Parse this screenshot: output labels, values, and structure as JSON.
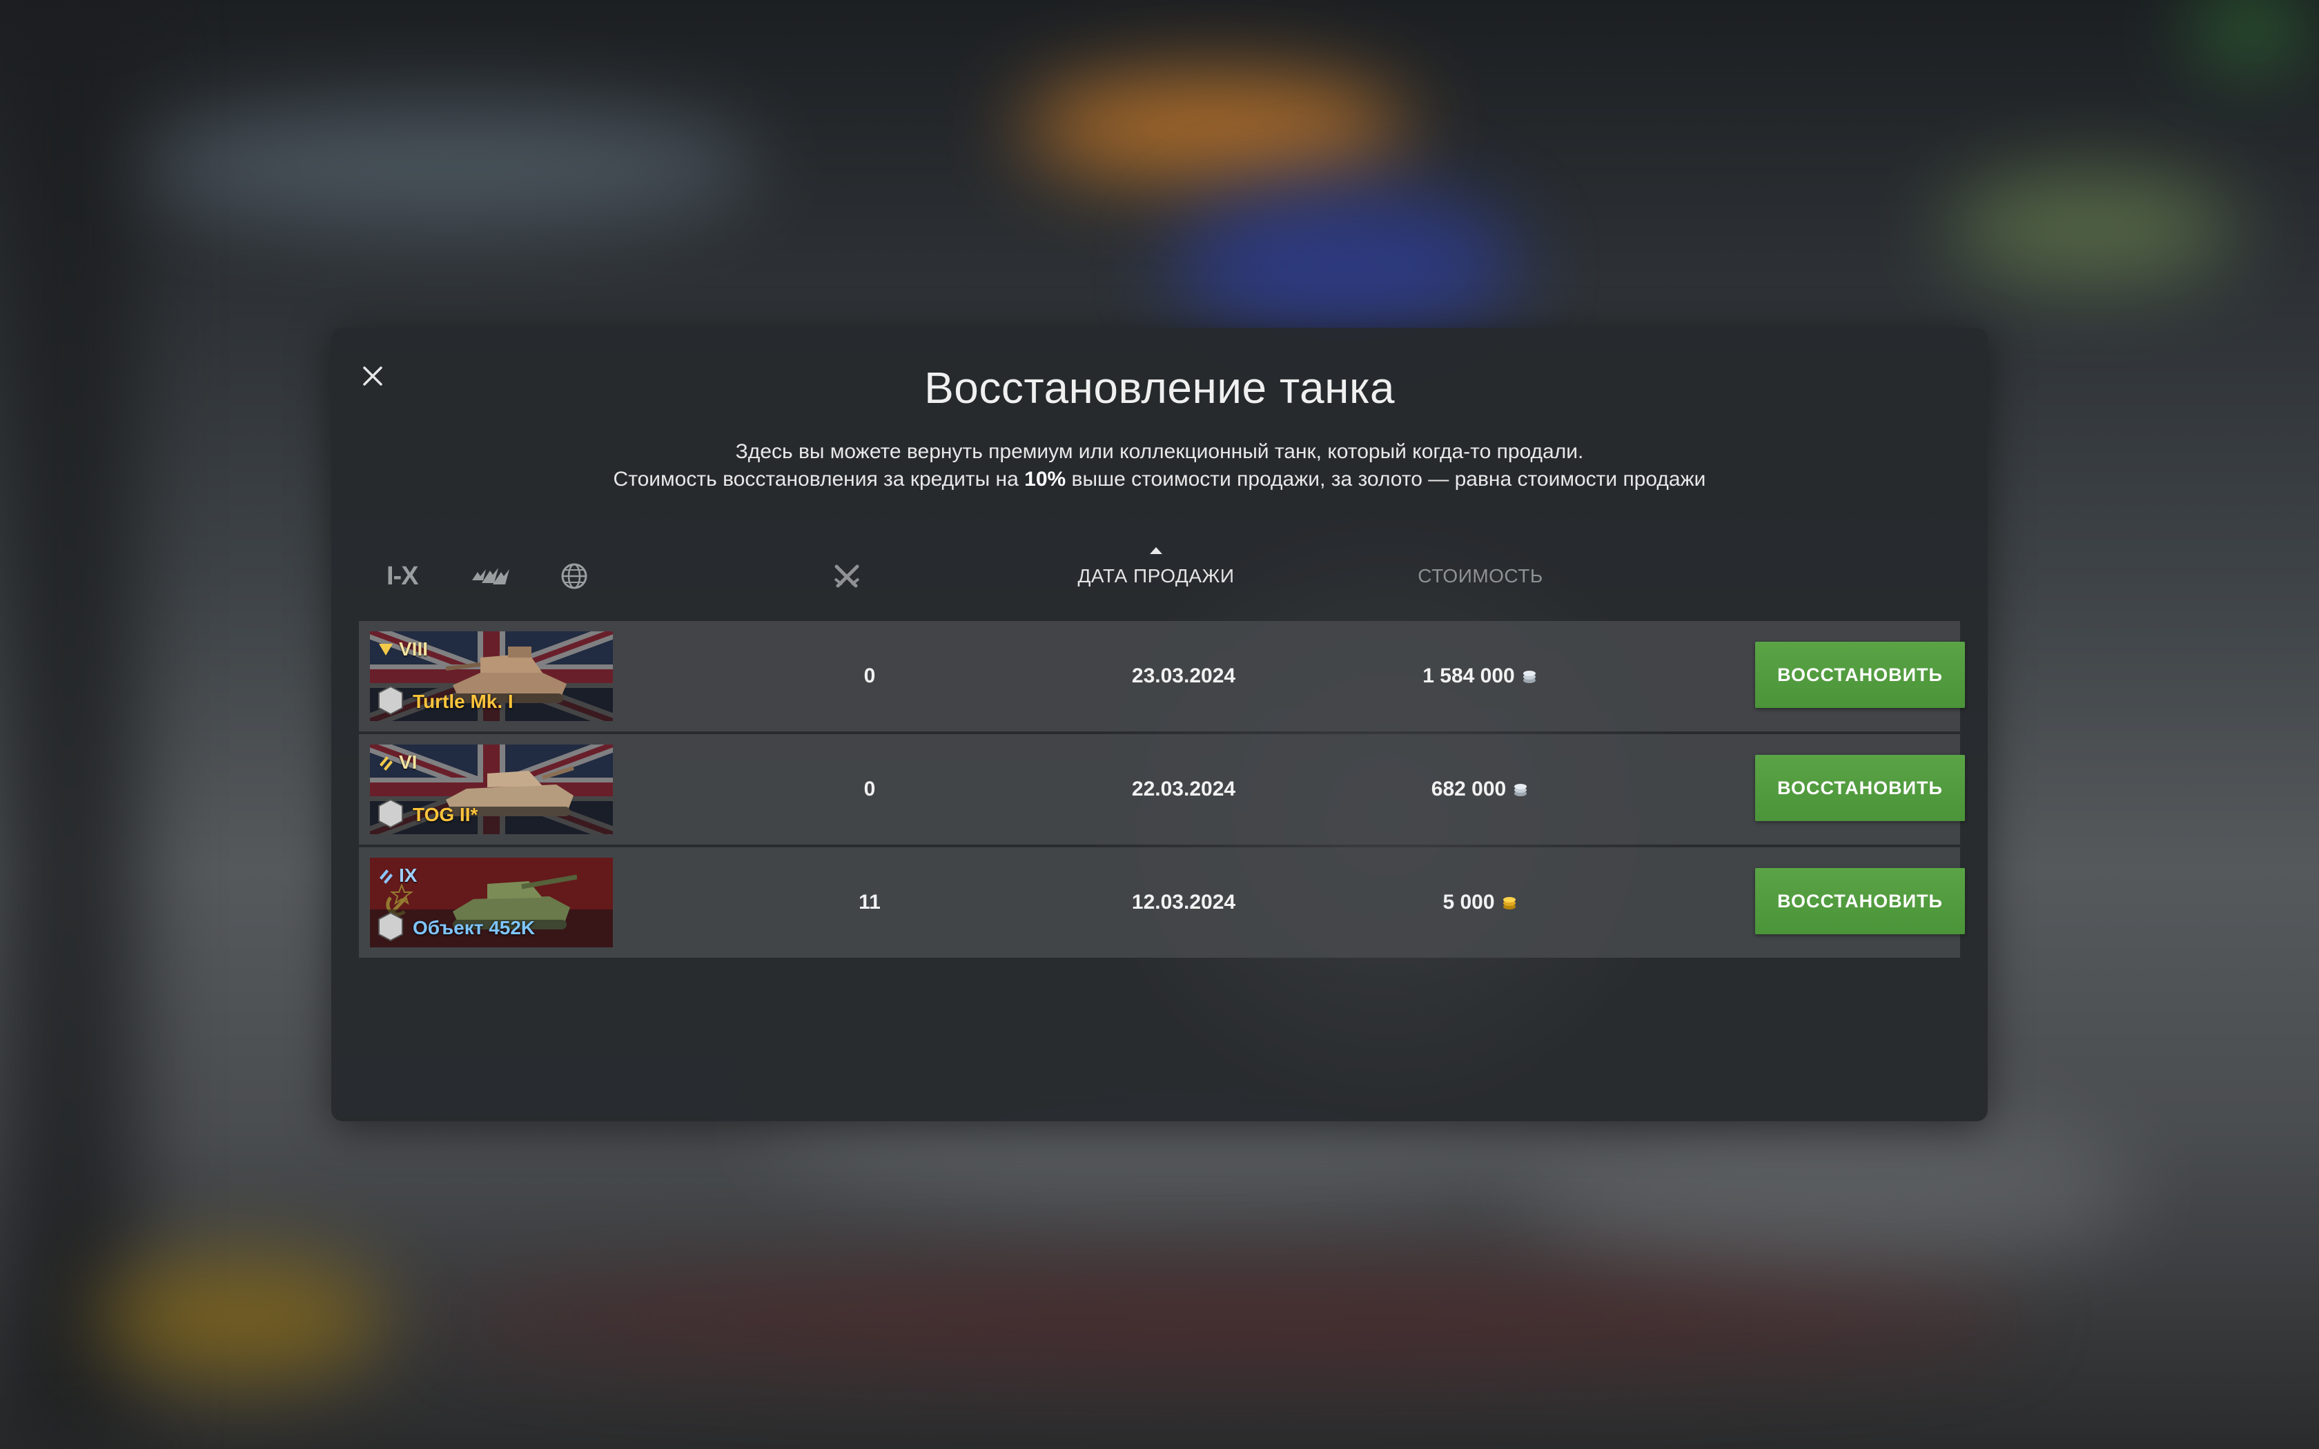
{
  "dialog": {
    "title": "Восстановление танка",
    "desc_line1": "Здесь вы можете вернуть премиум или коллекционный танк, который когда-то продали.",
    "desc_line2_pre": "Стоимость восстановления за кредиты на ",
    "desc_line2_bold": "10%",
    "desc_line2_post": " выше стоимости продажи, за золото — равна стоимости продажи"
  },
  "header": {
    "filter_tier": "I-X",
    "col_date": "ДАТА ПРОДАЖИ",
    "col_cost": "СТОИМОСТЬ",
    "sort": "date-ascending"
  },
  "rows": [
    {
      "tier": "VIII",
      "name": "Turtle Mk. I",
      "level": "1",
      "nation_flag": "uk-flag",
      "battles": "0",
      "date": "23.03.2024",
      "cost": "1 584 000",
      "currency_icon": "credits-icon",
      "button": "ВОССТАНОВИТЬ"
    },
    {
      "tier": "VI",
      "name": "TOG II*",
      "level": "1",
      "nation_flag": "uk-flag",
      "battles": "0",
      "date": "22.03.2024",
      "cost": "682 000",
      "currency_icon": "credits-icon",
      "button": "ВОССТАНОВИТЬ"
    },
    {
      "tier": "IX",
      "name": "Объект 452K",
      "level": "1",
      "nation_flag": "ussr-flag",
      "battles": "11",
      "date": "12.03.2024",
      "cost": "5 000",
      "currency_icon": "gold-icon",
      "button": "ВОССТАНОВИТЬ"
    }
  ],
  "colors": {
    "button_green": "#4f9a3c",
    "premium_name": "#ffc43c",
    "collector_name": "#7fc5ff"
  }
}
